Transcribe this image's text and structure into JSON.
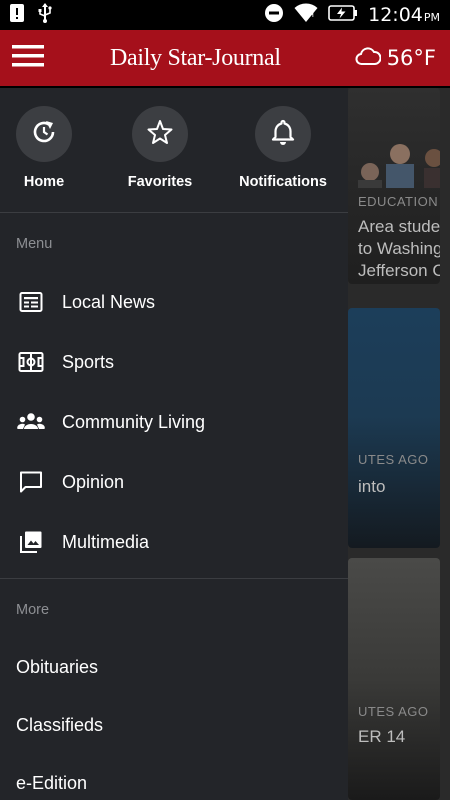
{
  "status_bar": {
    "time": "12:04",
    "ampm": "PM",
    "icons": [
      "alert-icon",
      "usb-icon",
      "do-not-disturb-icon",
      "wifi-icon",
      "battery-charging-icon"
    ]
  },
  "app_bar": {
    "brand": "Daily Star-Journal",
    "temperature": "56°F",
    "weather_icon": "cloud-icon"
  },
  "quick_actions": [
    {
      "label": "Home",
      "icon": "home-refresh-icon"
    },
    {
      "label": "Favorites",
      "icon": "star-icon"
    },
    {
      "label": "Notifications",
      "icon": "bell-icon"
    }
  ],
  "menu": {
    "section_label": "Menu",
    "items": [
      {
        "label": "Local News",
        "icon": "newspaper-icon"
      },
      {
        "label": "Sports",
        "icon": "sports-field-icon"
      },
      {
        "label": "Community Living",
        "icon": "people-icon"
      },
      {
        "label": "Opinion",
        "icon": "chat-icon"
      },
      {
        "label": "Multimedia",
        "icon": "photo-library-icon"
      }
    ]
  },
  "more": {
    "section_label": "More",
    "items": [
      "Obituaries",
      "Classifieds",
      "e-Edition"
    ]
  },
  "background_cards": [
    {
      "category": "EDUCATION I",
      "headline": [
        "Area stude",
        "to Washing",
        "Jefferson C"
      ]
    },
    {
      "category": "UTES AGO",
      "headline": [
        "into"
      ]
    },
    {
      "category": "UTES AGO",
      "headline": [
        "ER 14"
      ]
    }
  ],
  "colors": {
    "app_bar": "#a5101b",
    "drawer_bg": "#232529",
    "quick_circle": "#3c3e42",
    "section_label": "#8d8f93"
  }
}
